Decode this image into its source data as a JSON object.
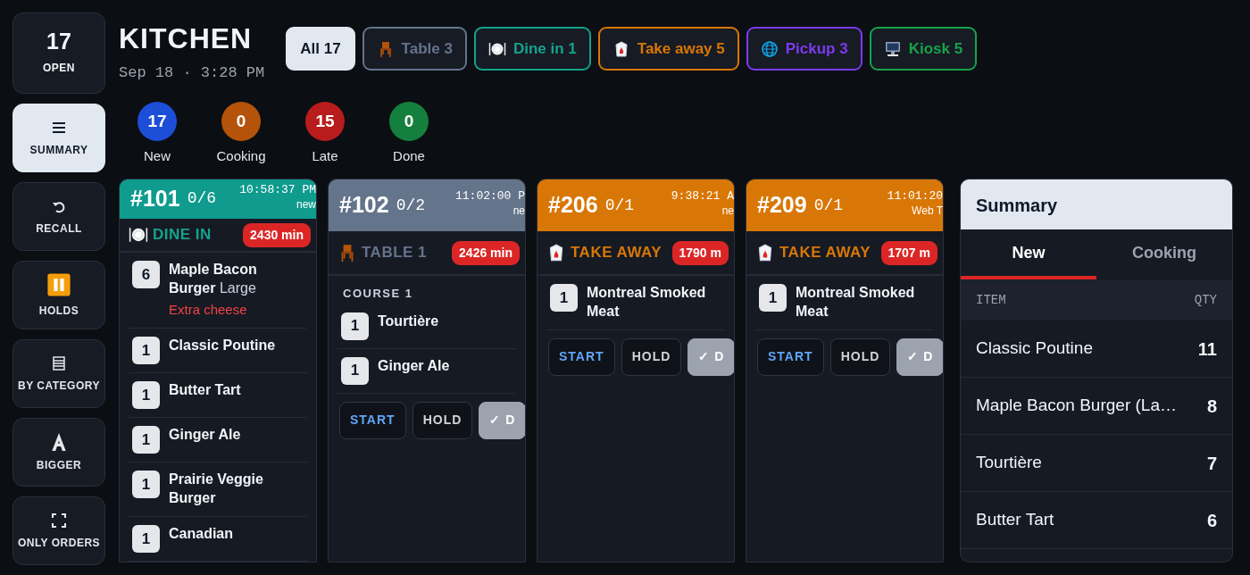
{
  "sidebar": {
    "open_count": {
      "value": "17",
      "label": "OPEN"
    },
    "items": [
      {
        "kind": "summary",
        "label": "SUMMARY",
        "selected": true
      },
      {
        "kind": "recall",
        "label": "RECALL",
        "selected": false
      },
      {
        "kind": "holds",
        "label": "HOLDS",
        "selected": false
      },
      {
        "kind": "category",
        "label": "BY CATEGORY",
        "selected": false
      },
      {
        "kind": "bigger",
        "label": "BIGGER",
        "selected": false
      },
      {
        "kind": "only_orders",
        "label": "ONLY ORDERS",
        "selected": false
      }
    ]
  },
  "header": {
    "title": "KITCHEN",
    "datetime": "Sep 18 · 3:28 PM"
  },
  "filters": [
    {
      "kind": "all",
      "label": "All 17",
      "selected": true,
      "color": "#e2e8f0"
    },
    {
      "kind": "table",
      "label": "Table 3",
      "selected": false,
      "color": "#64748b"
    },
    {
      "kind": "dine_in",
      "label": "Dine in 1",
      "selected": false,
      "color": "#14a38b"
    },
    {
      "kind": "take_away",
      "label": "Take away 5",
      "selected": false,
      "color": "#d97706"
    },
    {
      "kind": "pickup",
      "label": "Pickup 3",
      "selected": false,
      "color": "#7c3aed"
    },
    {
      "kind": "kiosk",
      "label": "Kiosk 5",
      "selected": false,
      "color": "#16a34a"
    }
  ],
  "status_counts": [
    {
      "count": "17",
      "label": "New",
      "color": "#1d4ed8"
    },
    {
      "count": "0",
      "label": "Cooking",
      "color": "#b45309"
    },
    {
      "count": "15",
      "label": "Late",
      "color": "#b91c1c"
    },
    {
      "count": "0",
      "label": "Done",
      "color": "#15803d"
    }
  ],
  "orders": [
    {
      "number": "#101",
      "progress": "0/6",
      "time": "10:58:37 PM",
      "source": "new",
      "color": "#0f9b8e",
      "kind": "dine_in",
      "type_label": "DINE IN",
      "elapsed": "2430 min",
      "items": [
        {
          "qty": "6",
          "name": "Maple Bacon Burger",
          "modifier": "Large",
          "note": "Extra cheese"
        },
        {
          "qty": "1",
          "name": "Classic Poutine"
        },
        {
          "qty": "1",
          "name": "Butter Tart"
        },
        {
          "qty": "1",
          "name": "Ginger Ale"
        },
        {
          "qty": "1",
          "name": "Prairie Veggie Burger"
        },
        {
          "qty": "1",
          "name": "Canadian"
        }
      ]
    },
    {
      "number": "#102",
      "progress": "0/2",
      "time": "11:02:00 P",
      "source": "ne",
      "color": "#64748b",
      "kind": "table",
      "type_label": "TABLE 1",
      "elapsed": "2426 min",
      "course": "COURSE 1",
      "items": [
        {
          "qty": "1",
          "name": "Tourtière"
        },
        {
          "qty": "1",
          "name": "Ginger Ale"
        }
      ],
      "actions": [
        "START",
        "HOLD",
        "✓ D"
      ]
    },
    {
      "number": "#206",
      "progress": "0/1",
      "time": "9:38:21 A",
      "source": "ne",
      "color": "#d97706",
      "kind": "take_away",
      "type_label": "TAKE AWAY",
      "elapsed": "1790 m",
      "items": [
        {
          "qty": "1",
          "name": "Montreal Smoked Meat"
        }
      ],
      "actions": [
        "START",
        "HOLD",
        "✓ D"
      ]
    },
    {
      "number": "#209",
      "progress": "0/1",
      "time": "11:01:20",
      "source": "Web T",
      "color": "#d97706",
      "kind": "take_away",
      "type_label": "TAKE AWAY",
      "elapsed": "1707 m",
      "items": [
        {
          "qty": "1",
          "name": "Montreal Smoked Meat"
        }
      ],
      "actions": [
        "START",
        "HOLD",
        "✓ D"
      ]
    }
  ],
  "summary": {
    "title": "Summary",
    "tabs": [
      {
        "label": "New",
        "selected": true
      },
      {
        "label": "Cooking",
        "selected": false
      }
    ],
    "columns": [
      "ITEM",
      "QTY"
    ],
    "rows": [
      {
        "item": "Classic Poutine",
        "qty": "11"
      },
      {
        "item": "Maple Bacon Burger (La…",
        "qty": "8"
      },
      {
        "item": "Tourtière",
        "qty": "7"
      },
      {
        "item": "Butter Tart",
        "qty": "6"
      }
    ]
  }
}
